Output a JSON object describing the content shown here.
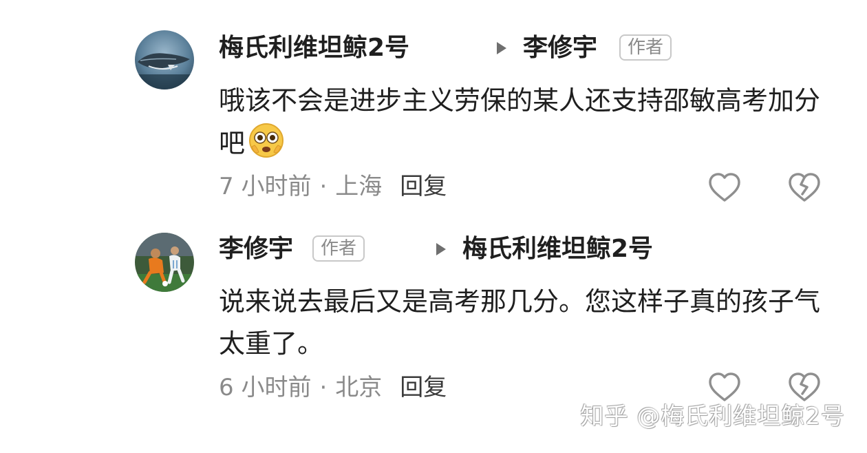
{
  "comments": [
    {
      "author": "梅氏利维坦鲸2号",
      "reply_to": "李修宇",
      "reply_to_badge": "作者",
      "text": "哦该不会是进步主义劳保的某人还支持邵敏高考加分吧",
      "emoji": "flushed-face-emoji",
      "time": "7 小时前",
      "separator": "·",
      "location": "上海",
      "reply_label": "回复",
      "like_icon": "heart-outline-icon",
      "dislike_icon": "broken-heart-icon"
    },
    {
      "author": "李修宇",
      "author_badge": "作者",
      "reply_to": "梅氏利维坦鲸2号",
      "text": "说来说去最后又是高考那几分。您这样子真的孩子气太重了。",
      "time": "6 小时前",
      "separator": "·",
      "location": "北京",
      "reply_label": "回复",
      "like_icon": "heart-outline-icon",
      "dislike_icon": "broken-heart-icon"
    }
  ],
  "watermark": "知乎 @梅氏利维坦鲸2号",
  "colors": {
    "text_primary": "#1f1f1f",
    "text_secondary": "#8a8a8a",
    "badge_border": "#c8c8c8",
    "icon_gray": "#8f8f8f"
  }
}
